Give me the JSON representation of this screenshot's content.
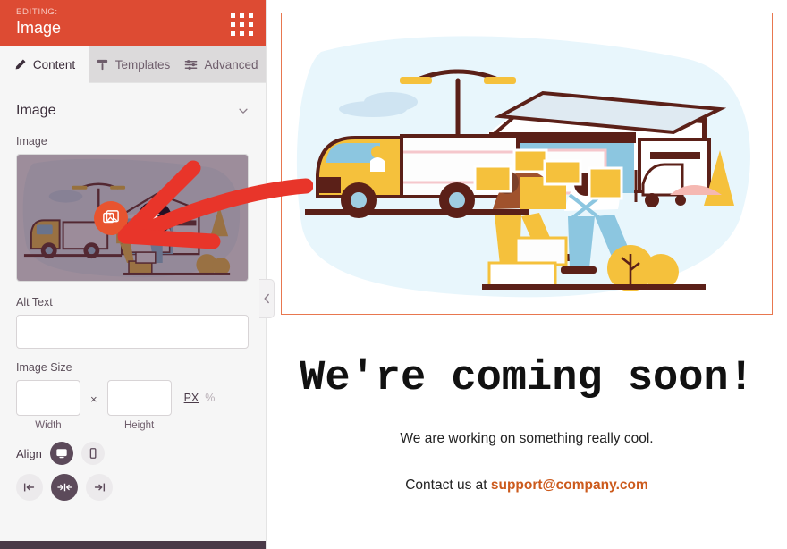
{
  "sidebar": {
    "header": {
      "editing_label": "EDITING:",
      "editing_name": "Image",
      "menu_icon": "grid-dots-icon"
    },
    "tabs": [
      {
        "label": "Content",
        "icon": "pencil-icon",
        "active": true
      },
      {
        "label": "Templates",
        "icon": "template-icon",
        "active": false
      },
      {
        "label": "Advanced",
        "icon": "sliders-icon",
        "active": false
      }
    ],
    "section": {
      "title": "Image",
      "chevron": "chevron-down-icon"
    },
    "image_field": {
      "label": "Image",
      "replace_button_icon": "images-gallery-icon",
      "delete_button_icon": "trash-icon"
    },
    "alt_text": {
      "label": "Alt Text",
      "value": "",
      "placeholder": ""
    },
    "image_size": {
      "label": "Image Size",
      "width": {
        "value": "",
        "caption": "Width"
      },
      "height": {
        "value": "",
        "caption": "Height"
      },
      "separator": "×",
      "units": [
        {
          "label": "PX",
          "active": true
        },
        {
          "label": "%",
          "active": false
        }
      ]
    },
    "align": {
      "label": "Align",
      "devices": [
        {
          "icon": "desktop-icon",
          "active": true
        },
        {
          "icon": "mobile-icon",
          "active": false
        }
      ],
      "options": [
        {
          "icon": "align-left-icon",
          "active": false
        },
        {
          "icon": "align-center-icon",
          "active": true
        },
        {
          "icon": "align-right-icon",
          "active": false
        }
      ]
    },
    "collapse_icon": "chevron-left-icon"
  },
  "preview": {
    "image_block": {
      "alt": "warehouse delivery illustration",
      "selected": true
    },
    "title": "We're coming soon!",
    "subtitle": "We are working on something really cool.",
    "contact_prefix": "Contact us at ",
    "contact_email": "support@company.com"
  },
  "annotation": {
    "type": "red-arrow",
    "points_to": "replace-image-button"
  },
  "colors": {
    "header_orange": "#dd4b33",
    "accent_orange": "#e8542f",
    "selection_border": "#e8774f",
    "email_link": "#cc5a1c",
    "footer_purple": "#4a3a48",
    "annotation_red": "#e8352a"
  }
}
